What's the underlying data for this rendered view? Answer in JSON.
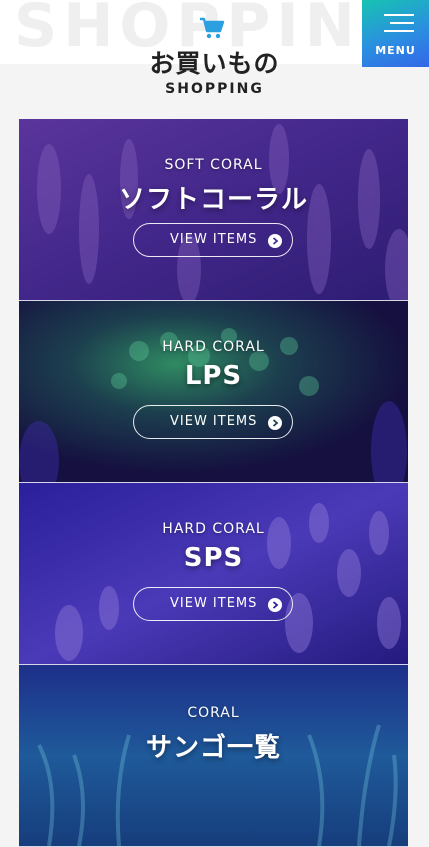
{
  "header": {
    "bg_word": "SHOPPING",
    "title": "お買いもの",
    "subtitle": "SHOPPING",
    "cart_icon": "cart-icon"
  },
  "menu": {
    "label": "MENU",
    "icon": "hamburger-icon"
  },
  "cards": [
    {
      "label": "SOFT CORAL",
      "title": "ソフトコーラル",
      "button": "VIEW ITEMS"
    },
    {
      "label": "HARD CORAL",
      "title": "LPS",
      "button": "VIEW ITEMS"
    },
    {
      "label": "HARD CORAL",
      "title": "SPS",
      "button": "VIEW ITEMS"
    },
    {
      "label": "CORAL",
      "title": "サンゴ一覧"
    }
  ],
  "colors": {
    "menu_gradient_start": "#17c3b2",
    "menu_gradient_end": "#3467e8",
    "cart_icon": "#2aa0e0",
    "card_overlay": "#4b2f9a"
  }
}
